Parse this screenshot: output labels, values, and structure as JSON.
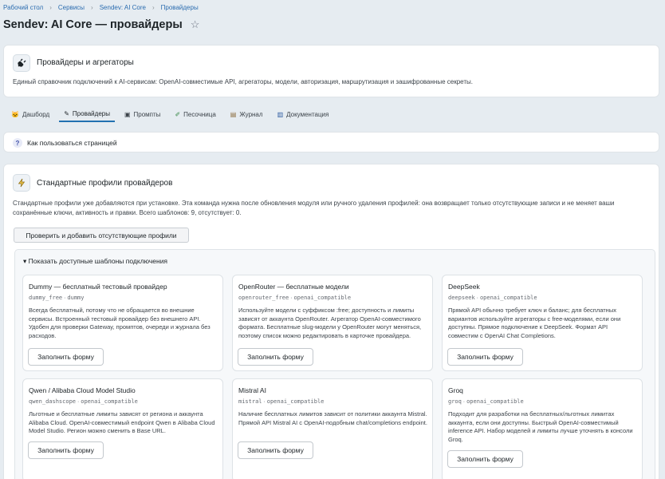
{
  "breadcrumbs": [
    "Рабочий стол",
    "Сервисы",
    "Sendev: AI Core",
    "Провайдеры"
  ],
  "page_title": "Sendev: AI Core — провайдеры",
  "intro": {
    "title": "Провайдеры и агрегаторы",
    "description": "Единый справочник подключений к AI-сервисам: OpenAI-совместимые API, агрегаторы, модели, авторизация, маршрутизация и зашифрованные секреты."
  },
  "tabs": [
    {
      "label": "Дашборд",
      "icon": "dashboard-icon",
      "active": false
    },
    {
      "label": "Провайдеры",
      "icon": "plug-icon",
      "active": true
    },
    {
      "label": "Промпты",
      "icon": "prompt-icon",
      "active": false
    },
    {
      "label": "Песочница",
      "icon": "pencil-icon",
      "active": false
    },
    {
      "label": "Журнал",
      "icon": "journal-icon",
      "active": false
    },
    {
      "label": "Документация",
      "icon": "book-icon",
      "active": false
    }
  ],
  "help": {
    "label": "Как пользоваться страницей"
  },
  "profiles": {
    "title": "Стандартные профили провайдеров",
    "description": "Стандартные профили уже добавляются при установке. Эта команда нужна после обновления модуля или ручного удаления профилей: она возвращает только отсутствующие записи и не меняет ваши сохранённые ключи, активность и правки. Всего шаблонов: 9, отсутствует: 0.",
    "button": "Проверить и добавить отсутствующие профили",
    "summary": "▾ Показать доступные шаблоны подключения",
    "fill_label": "Заполнить форму",
    "templates": [
      {
        "name": "Dummy — бесплатный тестовый провайдер",
        "code": "dummy_free",
        "kind": "dummy",
        "desc": "Всегда бесплатный, потому что не обращается во внешние сервисы. Встроенный тестовый провайдер без внешнего API. Удобен для проверки Gateway, промптов, очереди и журнала без расходов."
      },
      {
        "name": "OpenRouter — бесплатные модели",
        "code": "openrouter_free",
        "kind": "openai_compatible",
        "desc": "Используйте модели с суффиксом :free; доступность и лимиты зависят от аккаунта OpenRouter. Агрегатор OpenAI-совместимого формата. Бесплатные slug-модели у OpenRouter могут меняться, поэтому список можно редактировать в карточке провайдера."
      },
      {
        "name": "DeepSeek",
        "code": "deepseek",
        "kind": "openai_compatible",
        "desc": "Прямой API обычно требует ключ и баланс; для бесплатных вариантов используйте агрегаторы с free-моделями, если они доступны. Прямое подключение к DeepSeek. Формат API совместим с OpenAI Chat Completions."
      },
      {
        "name": "Qwen / Alibaba Cloud Model Studio",
        "code": "qwen_dashscope",
        "kind": "openai_compatible",
        "desc": "Льготные и бесплатные лимиты зависят от региона и аккаунта Alibaba Cloud. OpenAI-совместимый endpoint Qwen в Alibaba Cloud Model Studio. Регион можно сменить в Base URL."
      },
      {
        "name": "Mistral AI",
        "code": "mistral",
        "kind": "openai_compatible",
        "desc": "Наличие бесплатных лимитов зависит от политики аккаунта Mistral. Прямой API Mistral AI с OpenAI-подобным chat/completions endpoint."
      },
      {
        "name": "Groq",
        "code": "groq",
        "kind": "openai_compatible",
        "desc": "Подходит для разработки на бесплатных/льготных лимитах аккаунта, если они доступны. Быстрый OpenAI-совместимый inference API. Набор моделей и лимиты лучше уточнять в консоли Groq."
      }
    ]
  }
}
